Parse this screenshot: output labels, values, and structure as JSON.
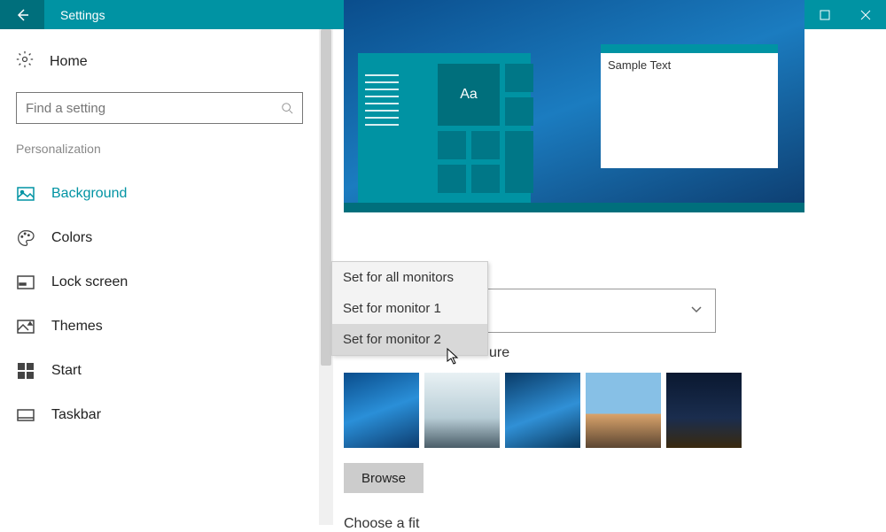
{
  "titlebar": {
    "title": "Settings"
  },
  "sidebar": {
    "home": "Home",
    "search_placeholder": "Find a setting",
    "category": "Personalization",
    "items": [
      {
        "label": "Background",
        "active": true
      },
      {
        "label": "Colors"
      },
      {
        "label": "Lock screen"
      },
      {
        "label": "Themes"
      },
      {
        "label": "Start"
      },
      {
        "label": "Taskbar"
      }
    ]
  },
  "preview": {
    "tile_caption": "Aa",
    "sample_window_text": "Sample Text"
  },
  "context_menu": {
    "items": [
      "Set for all monitors",
      "Set for monitor 1",
      "Set for monitor 2"
    ],
    "hovered_index": 2
  },
  "main": {
    "choose_picture_label_fragment": "ure",
    "browse_label": "Browse",
    "fit_label": "Choose a fit"
  }
}
